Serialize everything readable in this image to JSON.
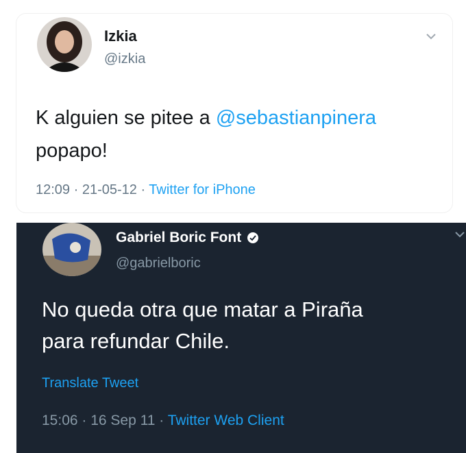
{
  "tweet1": {
    "author_name": "Izkia",
    "author_handle": "@izkia",
    "text_before": "K alguien se pitee a ",
    "mention": "@sebastianpinera",
    "text_after": "popapo!",
    "time": "12:09 · 21-05-12 · ",
    "source": "Twitter for iPhone",
    "icons": {
      "more": "chevron-down-icon"
    }
  },
  "tweet2": {
    "author_name": "Gabriel Boric Font",
    "author_handle": "@gabrielboric",
    "text_line1": "No queda otra que matar a Piraña",
    "text_line2": "para refundar Chile.",
    "translate_label": "Translate Tweet",
    "time": "15:06 · 16 Sep 11 · ",
    "source": "Twitter Web Client",
    "icons": {
      "verified": "verified-badge-icon",
      "more": "chevron-down-icon"
    }
  },
  "colors": {
    "link": "#1da1f2",
    "dark_background": "#1b2430",
    "muted_light": "#657786",
    "muted_dark": "#8899a6"
  }
}
